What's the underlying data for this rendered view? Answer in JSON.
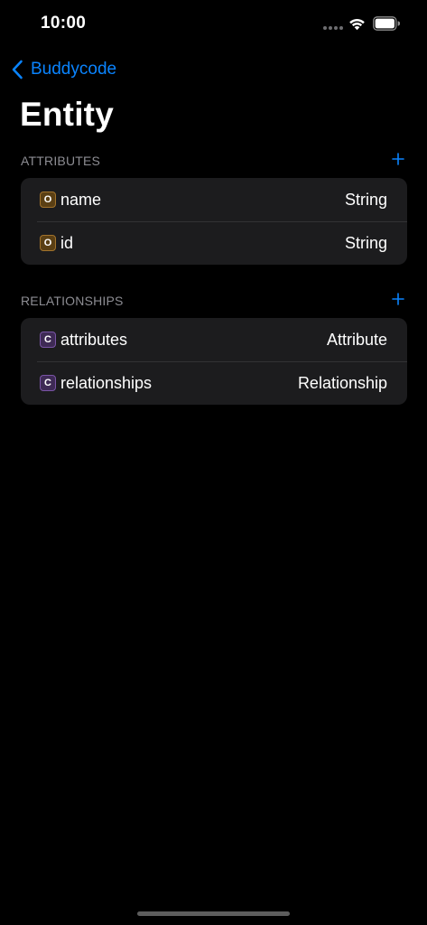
{
  "status_bar": {
    "time": "10:00"
  },
  "nav": {
    "back_label": "Buddycode",
    "title": "Entity"
  },
  "colors": {
    "accent": "#0a84ff",
    "background": "#000000",
    "card": "#1c1c1e",
    "section_title": "#8d8d93",
    "optional_badge": "#a2732c",
    "class_badge": "#7a54a6"
  },
  "icons": {
    "back": "chevron-left-icon",
    "add": "plus-icon",
    "wifi": "wifi-icon",
    "battery": "battery-icon"
  },
  "attributes": {
    "title": "ATTRIBUTES",
    "items": [
      {
        "badge": "O",
        "name": "name",
        "type": "String"
      },
      {
        "badge": "O",
        "name": "id",
        "type": "String"
      }
    ]
  },
  "relationships": {
    "title": "RELATIONSHIPS",
    "items": [
      {
        "badge": "C",
        "name": "attributes",
        "type": "Attribute"
      },
      {
        "badge": "C",
        "name": "relationships",
        "type": "Relationship"
      }
    ]
  }
}
